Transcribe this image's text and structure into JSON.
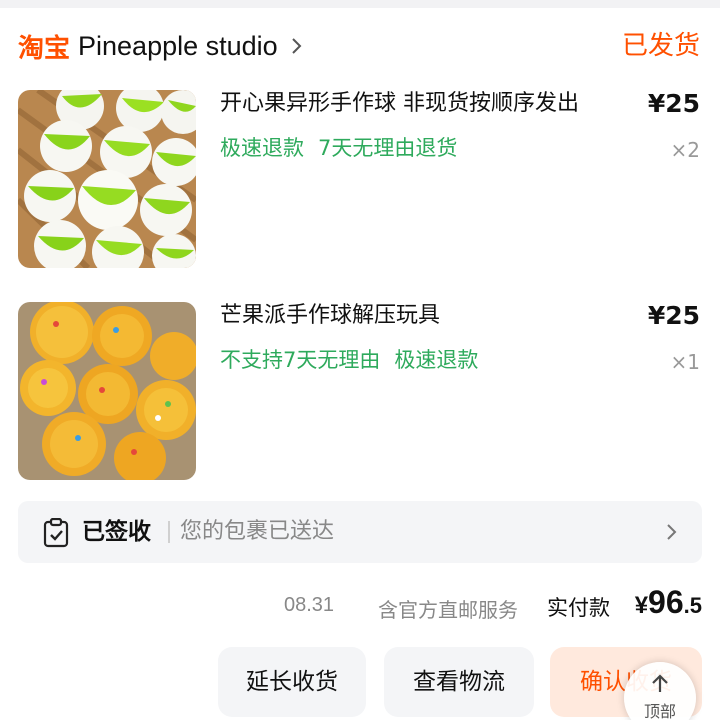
{
  "header": {
    "platform": "淘宝",
    "shop_name": "Pineapple studio",
    "order_status": "已发货",
    "icons": [
      "chevron-right-icon"
    ]
  },
  "products": [
    {
      "title": "开心果异形手作球 非现货按顺序发出",
      "price": "¥25",
      "tags": [
        "极速退款",
        "7天无理由退货"
      ],
      "quantity": "×2"
    },
    {
      "title": "芒果派手作球解压玩具",
      "price": "¥25",
      "tags": [
        "不支持7天无理由",
        "极速退款"
      ],
      "quantity": "×1"
    }
  ],
  "delivery": {
    "status": "已签收",
    "message": "您的包裹已送达",
    "icons": [
      "clipboard-check-icon",
      "chevron-right-icon"
    ]
  },
  "summary": {
    "date": "08.31",
    "service": "含官方直邮服务",
    "paid_label": "实付款",
    "paid_currency": "¥",
    "paid_integer": "96",
    "paid_decimal": ".5"
  },
  "actions": {
    "extend": "延长收货",
    "logistics": "查看物流",
    "confirm": "确认收货"
  },
  "floating": {
    "top_label": "顶部",
    "icon": "arrow-up-icon"
  },
  "colors": {
    "accent": "#ff5000",
    "tag_green": "#2eaa5c",
    "muted": "#888888",
    "panel": "#f4f5f7"
  }
}
